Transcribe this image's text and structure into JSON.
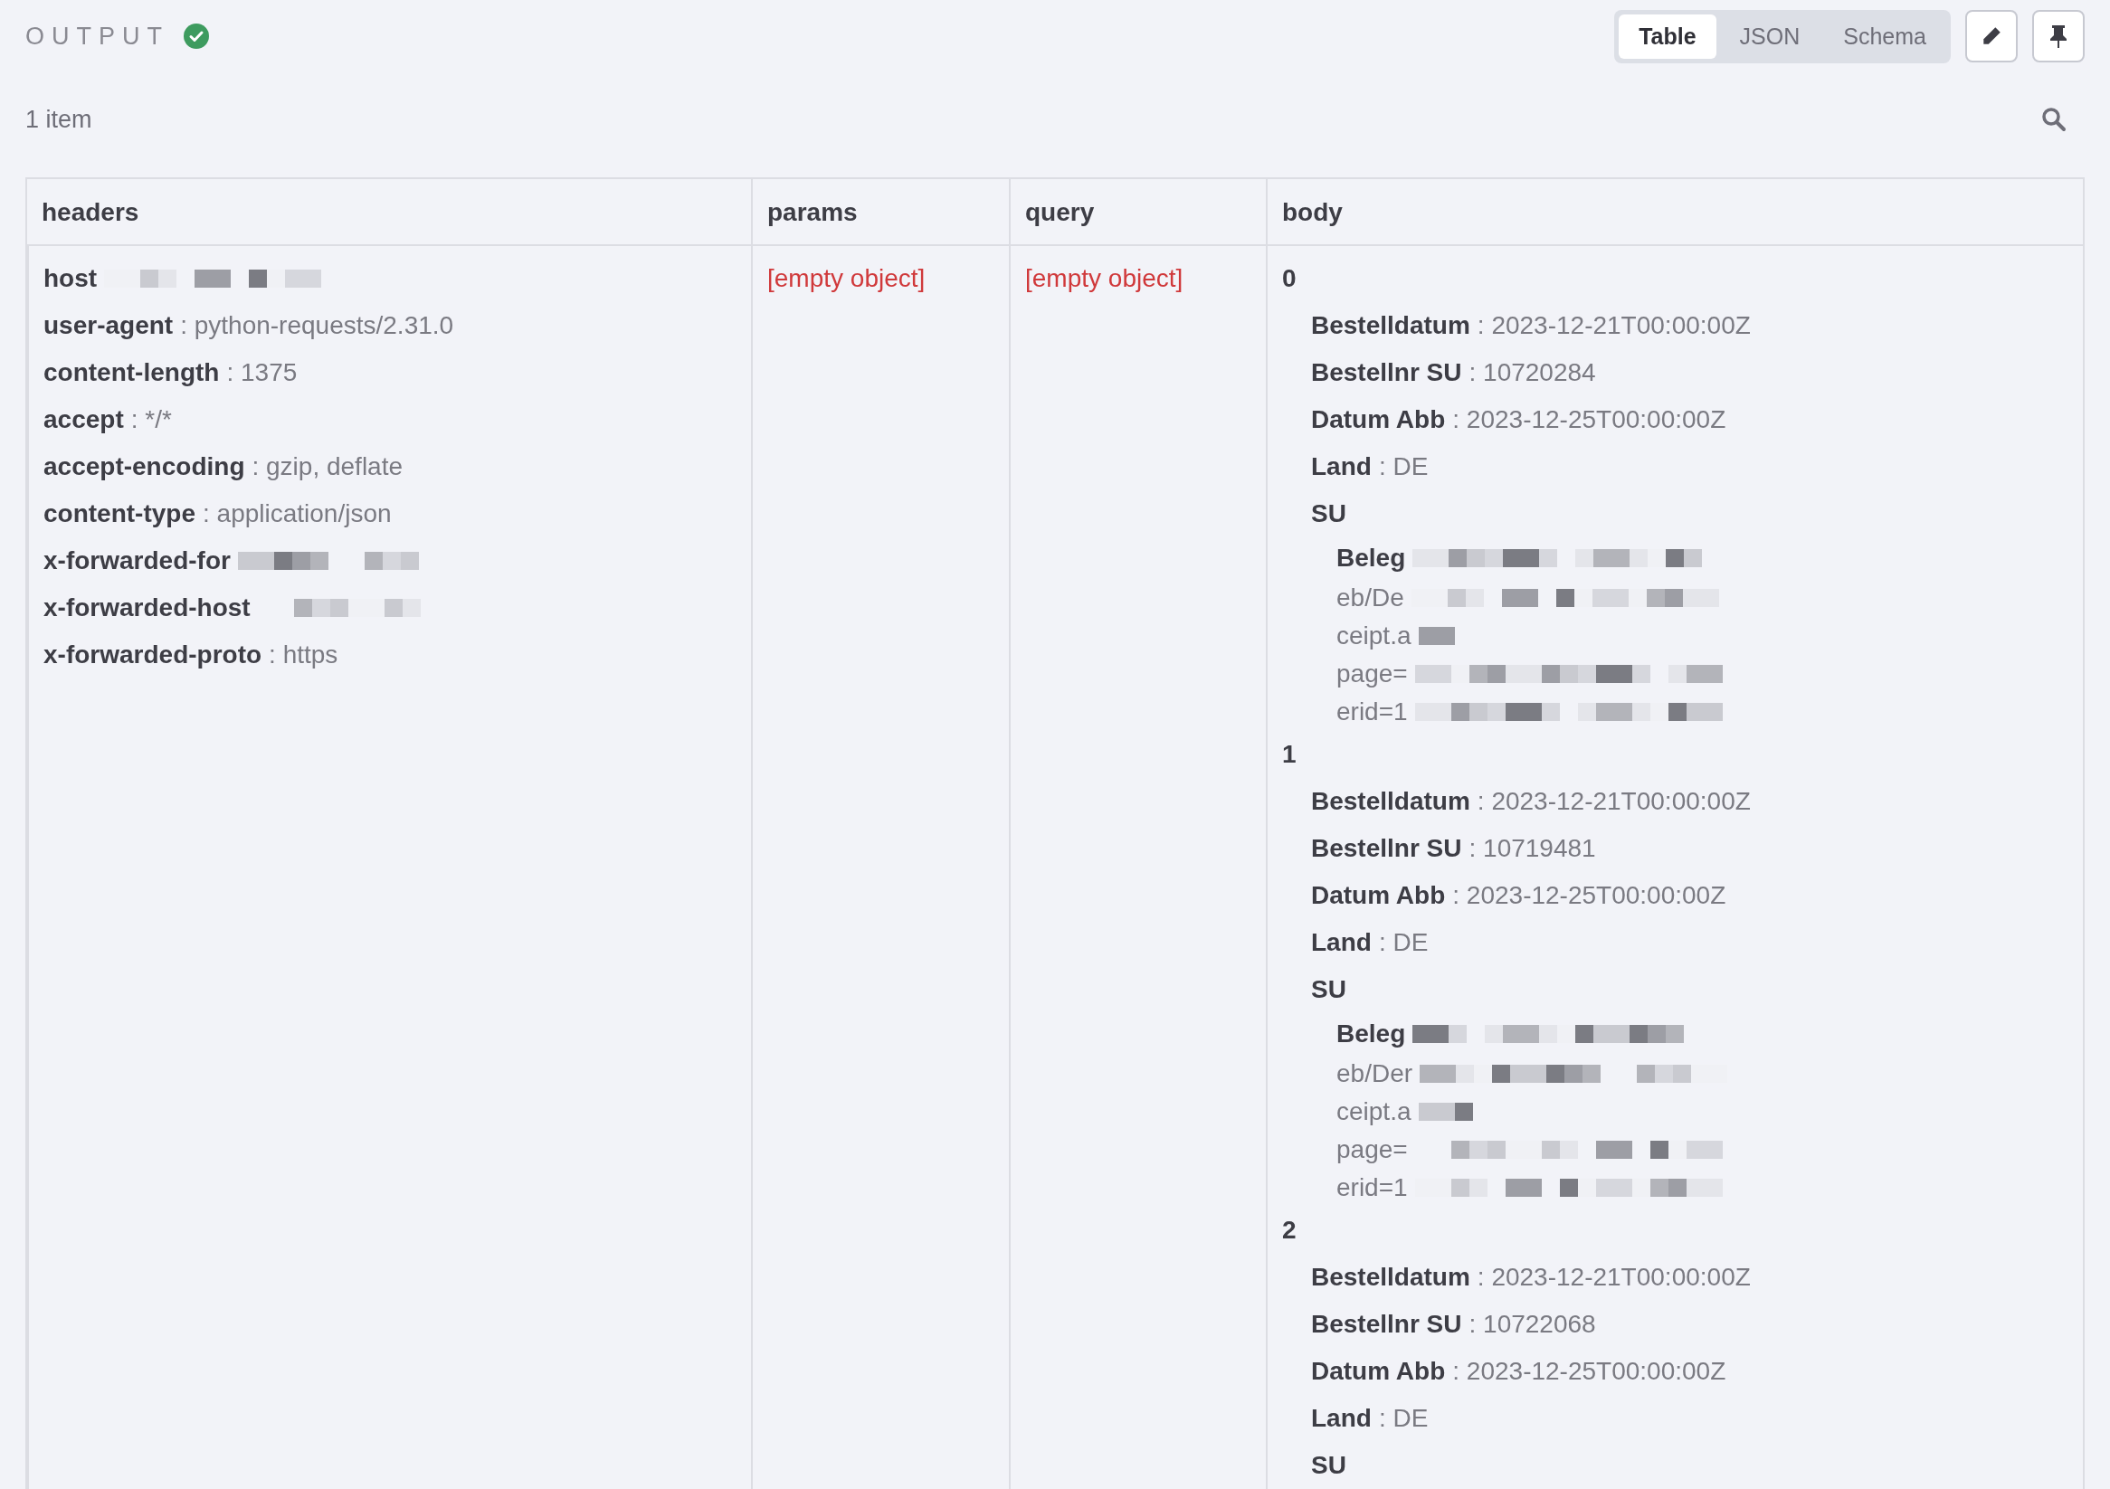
{
  "panel": {
    "title": "OUTPUT",
    "success": true
  },
  "view_tabs": [
    {
      "label": "Table",
      "selected": true
    },
    {
      "label": "JSON",
      "selected": false
    },
    {
      "label": "Schema",
      "selected": false
    }
  ],
  "item_count": "1 item",
  "table": {
    "columns": [
      "headers",
      "params",
      "query",
      "body"
    ],
    "row": {
      "headers": [
        {
          "key": "host",
          "redacted": true
        },
        {
          "key": "user-agent",
          "value": ": python-requests/2.31.0"
        },
        {
          "key": "content-length",
          "value": ": 1375"
        },
        {
          "key": "accept",
          "value": ": */*"
        },
        {
          "key": "accept-encoding",
          "value": ": gzip, deflate"
        },
        {
          "key": "content-type",
          "value": ": application/json"
        },
        {
          "key": "x-forwarded-for",
          "redacted": true
        },
        {
          "key": "x-forwarded-host",
          "redacted": true
        },
        {
          "key": "x-forwarded-proto",
          "value": ": https"
        }
      ],
      "params": "[empty object]",
      "query": "[empty object]",
      "body": [
        {
          "index": "0",
          "fields": [
            {
              "key": "Bestelldatum",
              "value": ": 2023-12-21T00:00:00Z"
            },
            {
              "key": "Bestellnr SU",
              "value": ": 10720284"
            },
            {
              "key": "Datum Abb",
              "value": ": 2023-12-25T00:00:00Z"
            },
            {
              "key": "Land",
              "value": ": DE"
            }
          ],
          "nested": {
            "key": "SU",
            "fields": [
              {
                "key": "Beleg",
                "redacted": true,
                "lines": [
                  "eb/De",
                  "ceipt.a",
                  "page=",
                  "erid=1"
                ]
              }
            ]
          }
        },
        {
          "index": "1",
          "fields": [
            {
              "key": "Bestelldatum",
              "value": ": 2023-12-21T00:00:00Z"
            },
            {
              "key": "Bestellnr SU",
              "value": ": 10719481"
            },
            {
              "key": "Datum Abb",
              "value": ": 2023-12-25T00:00:00Z"
            },
            {
              "key": "Land",
              "value": ": DE"
            }
          ],
          "nested": {
            "key": "SU",
            "fields": [
              {
                "key": "Beleg",
                "redacted": true,
                "lines": [
                  "eb/Der",
                  "ceipt.a",
                  "page=",
                  "erid=1"
                ]
              }
            ]
          }
        },
        {
          "index": "2",
          "fields": [
            {
              "key": "Bestelldatum",
              "value": ": 2023-12-21T00:00:00Z"
            },
            {
              "key": "Bestellnr SU",
              "value": ": 10722068"
            },
            {
              "key": "Datum Abb",
              "value": ": 2023-12-25T00:00:00Z"
            },
            {
              "key": "Land",
              "value": ": DE"
            }
          ],
          "nested": {
            "key": "SU"
          }
        }
      ]
    }
  }
}
